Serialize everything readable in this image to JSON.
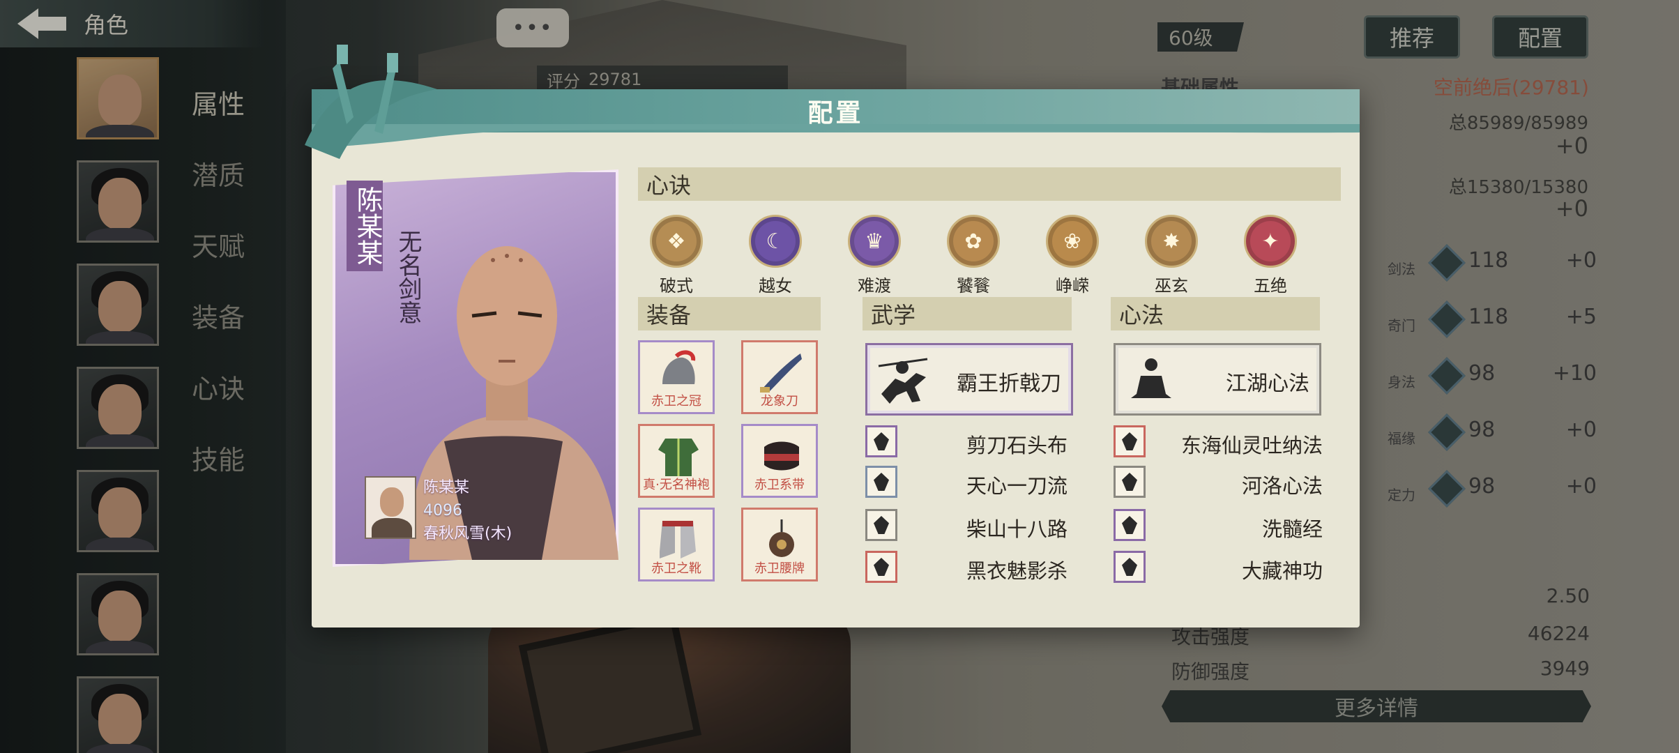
{
  "app": {
    "back_title": "角色"
  },
  "side_menu": [
    "属性",
    "潜质",
    "天赋",
    "装备",
    "心诀",
    "技能"
  ],
  "background": {
    "chat": "•••",
    "score_label": "评分",
    "score_value": "29781",
    "level": "60级",
    "btn_recommend": "推荐",
    "btn_config": "配置",
    "stats_heading": "基础属性",
    "stats_rank": "空前绝后(29781)",
    "hp_total": "总85989/85989",
    "hp_delta": "+0",
    "mp_total": "总15380/15380",
    "mp_delta": "+0",
    "attrs": [
      {
        "label": "剑法",
        "value": "118",
        "delta": "+0"
      },
      {
        "label": "奇门",
        "value": "118",
        "delta": "+5"
      },
      {
        "label": "身法",
        "value": "98",
        "delta": "+10"
      },
      {
        "label": "福缘",
        "value": "98",
        "delta": "+0"
      },
      {
        "label": "定力",
        "value": "98",
        "delta": "+0"
      }
    ],
    "lower_stats": [
      {
        "label": "",
        "value": "2.50"
      },
      {
        "label": "攻击强度",
        "value": "46224"
      },
      {
        "label": "防御强度",
        "value": "3949"
      }
    ],
    "more_details": "更多详情"
  },
  "modal": {
    "title": "配置",
    "card": {
      "name": "陈某某",
      "subtitle": "无名剑意",
      "mini_name": "陈某某",
      "mini_power": "4096",
      "mini_server": "春秋风雪(木)"
    },
    "xinjue_header": "心诀",
    "xinjue": [
      {
        "name": "破式",
        "color": "#b58d54"
      },
      {
        "name": "越女",
        "color": "#6d53a6"
      },
      {
        "name": "难渡",
        "color": "#7b5aa8"
      },
      {
        "name": "饕餮",
        "color": "#b88a50"
      },
      {
        "name": "峥嵘",
        "color": "#b98a4c"
      },
      {
        "name": "巫玄",
        "color": "#b48a52"
      },
      {
        "name": "五绝",
        "color": "#b84a58"
      }
    ],
    "equip_header": "装备",
    "equipment": [
      {
        "name": "赤卫之冠",
        "rarity": "purple",
        "color": "#7d8086"
      },
      {
        "name": "龙象刀",
        "rarity": "red",
        "color": "#3e4f78"
      },
      {
        "name": "真·无名神袍",
        "rarity": "red",
        "color": "#3f6d3a"
      },
      {
        "name": "赤卫系带",
        "rarity": "purple",
        "color": "#6e2a2a"
      },
      {
        "name": "赤卫之靴",
        "rarity": "purple",
        "color": "#a8a8ac"
      },
      {
        "name": "赤卫腰牌",
        "rarity": "red",
        "color": "#5b4030"
      }
    ],
    "wuxue_header": "武学",
    "wuxue_main": "霸王折戟刀",
    "wuxue": [
      {
        "name": "剪刀石头布",
        "border": "purple"
      },
      {
        "name": "天心一刀流",
        "border": "blue"
      },
      {
        "name": "柴山十八路",
        "border": "gray"
      },
      {
        "name": "黑衣魅影杀",
        "border": "red"
      }
    ],
    "xinfa_header": "心法",
    "xinfa_main": "江湖心法",
    "xinfa": [
      {
        "name": "东海仙灵吐纳法",
        "border": "red"
      },
      {
        "name": "河洛心法",
        "border": "gray"
      },
      {
        "name": "洗髓经",
        "border": "purple"
      },
      {
        "name": "大藏神功",
        "border": "purple"
      }
    ]
  }
}
